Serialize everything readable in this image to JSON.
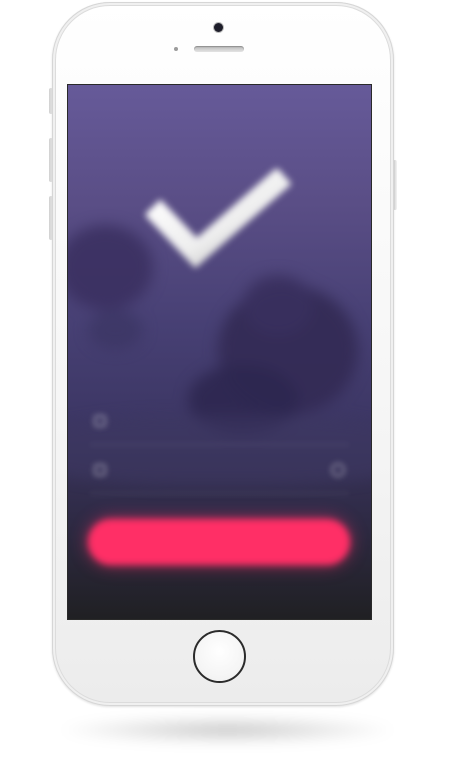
{
  "device": {
    "model_icon": "iphone-frame",
    "frame_color": "#f4f4f4",
    "home_button_icon": "home-button-ring"
  },
  "screen": {
    "background_top": "#665a99",
    "background_bottom": "#202023",
    "hero_icon": "checkmark-icon",
    "fields": [
      {
        "label": "",
        "icon": "user-icon"
      },
      {
        "label": "",
        "icon": "lock-icon",
        "trailing_icon": "eye-icon"
      }
    ],
    "primary_button": {
      "label": "",
      "color": "#ff2f66"
    },
    "footer": {
      "text": "",
      "link": ""
    }
  }
}
